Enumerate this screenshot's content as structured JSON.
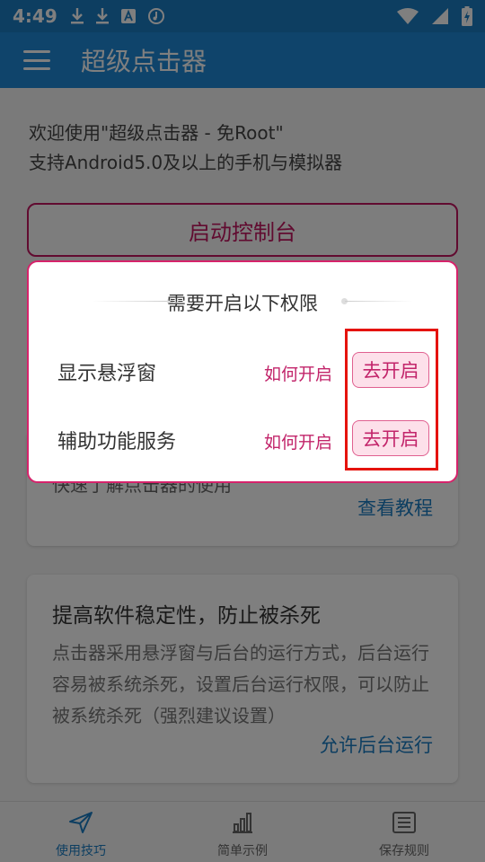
{
  "status_bar": {
    "time": "4:49",
    "icons": [
      "download-icon",
      "download-icon",
      "accessibility-icon",
      "music-icon",
      "wifi-icon",
      "signal-icon",
      "battery-icon"
    ]
  },
  "app_bar": {
    "title": "超级点击器"
  },
  "welcome": {
    "line1": "欢迎使用\"超级点击器 - 免Root\"",
    "line2": "支持Android5.0及以上的手机与模拟器"
  },
  "launch_button": "启动控制台",
  "card_tutorial": {
    "partial_text": "快速了解点击器的使用",
    "link": "查看教程"
  },
  "card_stability": {
    "title": "提高软件稳定性，防止被杀死",
    "text": "点击器采用悬浮窗与后台的运行方式，后台运行容易被系统杀死，设置后台运行权限，可以防止被系统杀死（强烈建议设置）",
    "link": "允许后台运行"
  },
  "bottom_nav": [
    {
      "label": "使用技巧",
      "icon": "send-icon",
      "active": true
    },
    {
      "label": "简单示例",
      "icon": "bar-chart-icon",
      "active": false
    },
    {
      "label": "保存规则",
      "icon": "list-icon",
      "active": false
    }
  ],
  "dialog": {
    "title": "需要开启以下权限",
    "permissions": [
      {
        "label": "显示悬浮窗",
        "how": "如何开启",
        "go": "去开启"
      },
      {
        "label": "辅助功能服务",
        "how": "如何开启",
        "go": "去开启"
      }
    ]
  },
  "colors": {
    "primary": "#1e88d6",
    "status_bar": "#1b7dc3",
    "accent": "#c2246a",
    "highlight_box": "#e5130d"
  }
}
